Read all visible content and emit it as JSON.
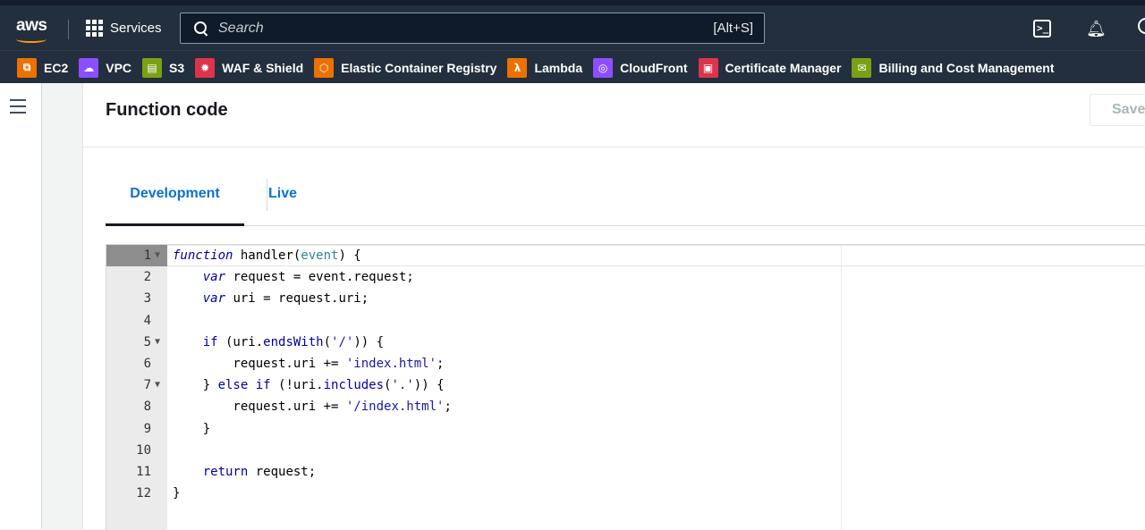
{
  "topnav": {
    "logo_text": "aws",
    "services_label": "Services",
    "search_placeholder": "Search",
    "search_shortcut": "[Alt+S]"
  },
  "favorites": [
    {
      "label": "EC2",
      "icon": "ec2-icon",
      "color": "#ed7100"
    },
    {
      "label": "VPC",
      "icon": "vpc-icon",
      "color": "#8c4fff"
    },
    {
      "label": "S3",
      "icon": "s3-icon",
      "color": "#7aa116"
    },
    {
      "label": "WAF & Shield",
      "icon": "waf-icon",
      "color": "#dd344c"
    },
    {
      "label": "Elastic Container Registry",
      "icon": "ecr-icon",
      "color": "#ed7100"
    },
    {
      "label": "Lambda",
      "icon": "lambda-icon",
      "color": "#ed7100"
    },
    {
      "label": "CloudFront",
      "icon": "cloudfront-icon",
      "color": "#8c4fff"
    },
    {
      "label": "Certificate Manager",
      "icon": "certificate-icon",
      "color": "#dd344c"
    },
    {
      "label": "Billing and Cost Management",
      "icon": "billing-icon",
      "color": "#7aa116"
    }
  ],
  "main": {
    "title": "Function code",
    "save_label": "Save",
    "tabs": [
      {
        "label": "Development",
        "active": true
      },
      {
        "label": "Live",
        "active": false
      }
    ]
  },
  "editor": {
    "lines": [
      {
        "num": "1",
        "fold": true,
        "code": "function handler(event) {"
      },
      {
        "num": "2",
        "fold": false,
        "code": "    var request = event.request;"
      },
      {
        "num": "3",
        "fold": false,
        "code": "    var uri = request.uri;"
      },
      {
        "num": "4",
        "fold": false,
        "code": ""
      },
      {
        "num": "5",
        "fold": true,
        "code": "    if (uri.endsWith('/')) {"
      },
      {
        "num": "6",
        "fold": false,
        "code": "        request.uri += 'index.html';"
      },
      {
        "num": "7",
        "fold": true,
        "code": "    } else if (!uri.includes('.')) {"
      },
      {
        "num": "8",
        "fold": false,
        "code": "        request.uri += '/index.html';"
      },
      {
        "num": "9",
        "fold": false,
        "code": "    }"
      },
      {
        "num": "10",
        "fold": false,
        "code": ""
      },
      {
        "num": "11",
        "fold": false,
        "code": "    return request;"
      },
      {
        "num": "12",
        "fold": false,
        "code": "}"
      }
    ]
  }
}
